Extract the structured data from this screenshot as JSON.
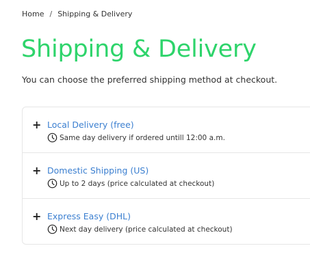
{
  "breadcrumb": {
    "home": "Home",
    "separator": "/",
    "current": "Shipping & Delivery"
  },
  "page": {
    "title": "Shipping & Delivery",
    "subtitle": "You can choose the preferred shipping method at checkout."
  },
  "colors": {
    "title_green": "#2ed46b",
    "link_blue": "#3b7fd0"
  },
  "shipping_options": [
    {
      "expand_symbol": "+",
      "title": "Local Delivery (free)",
      "icon": "clock-icon",
      "detail": "Same day delivery if ordered untill 12:00 a.m."
    },
    {
      "expand_symbol": "+",
      "title": "Domestic Shipping (US)",
      "icon": "clock-icon",
      "detail": "Up to 2 days (price calculated at checkout)"
    },
    {
      "expand_symbol": "+",
      "title": "Express Easy (DHL)",
      "icon": "clock-icon",
      "detail": "Next day delivery (price calculated at checkout)"
    }
  ]
}
